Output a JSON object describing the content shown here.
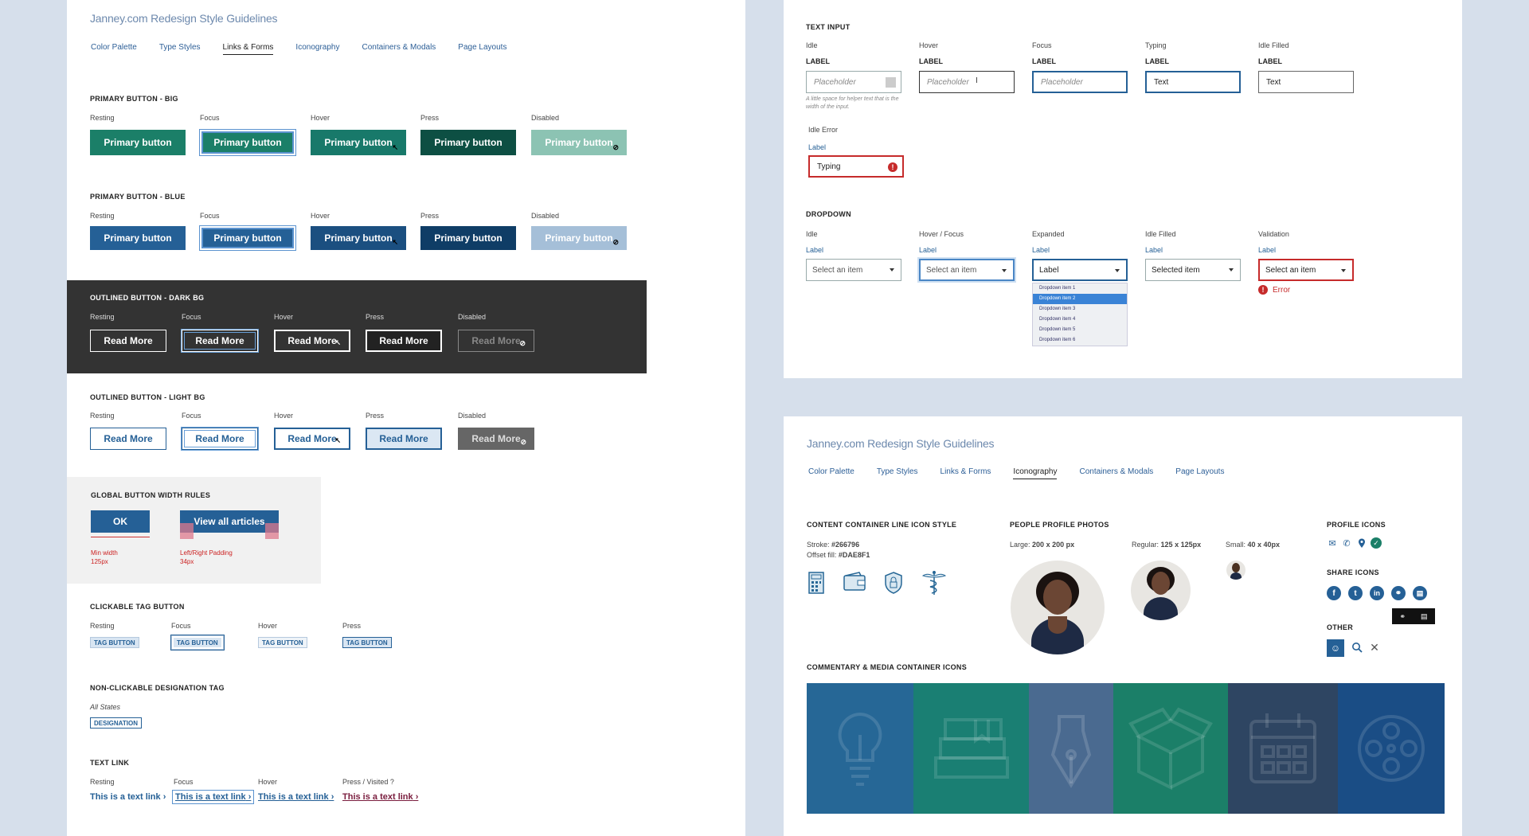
{
  "left": {
    "title": "Janney.com Redesign Style Guidelines",
    "nav": [
      "Color Palette",
      "Type Styles",
      "Links & Forms",
      "Iconography",
      "Containers & Modals",
      "Page Layouts"
    ],
    "pb_big": {
      "heading": "PRIMARY BUTTON - BIG",
      "states": [
        "Resting",
        "Focus",
        "Hover",
        "Press",
        "Disabled"
      ],
      "label": "Primary button"
    },
    "pb_blue": {
      "heading": "PRIMARY BUTTON - BLUE",
      "states": [
        "Resting",
        "Focus",
        "Hover",
        "Press",
        "Disabled"
      ],
      "label": "Primary button"
    },
    "ob_dark": {
      "heading": "OUTLINED BUTTON - DARK BG",
      "states": [
        "Resting",
        "Focus",
        "Hover",
        "Press",
        "Disabled"
      ],
      "label": "Read More"
    },
    "ob_light": {
      "heading": "OUTLINED BUTTON - LIGHT BG",
      "states": [
        "Resting",
        "Focus",
        "Hover",
        "Press",
        "Disabled"
      ],
      "label": "Read More"
    },
    "gbw": {
      "heading": "GLOBAL BUTTON WIDTH RULES",
      "ok": "OK",
      "view": "View all articles",
      "min_a": "Min width",
      "min_b": "125px",
      "pad_a": "Left/Right Padding",
      "pad_b": "34px"
    },
    "tag": {
      "heading": "CLICKABLE TAG BUTTON",
      "states": [
        "Resting",
        "Focus",
        "Hover",
        "Press"
      ],
      "label": "TAG BUTTON"
    },
    "des": {
      "heading": "NON-CLICKABLE DESIGNATION TAG",
      "state": "All States",
      "label": "DESIGNATION"
    },
    "link": {
      "heading": "TEXT LINK",
      "states": [
        "Resting",
        "Focus",
        "Hover",
        "Press / Visited ?"
      ],
      "label": "This is a text link"
    }
  },
  "topright": {
    "ti_heading": "TEXT INPUT",
    "ti_states": [
      "Idle",
      "Hover",
      "Focus",
      "Typing",
      "Idle Filled"
    ],
    "ti_label": "LABEL",
    "ti_values": [
      "Placeholder",
      "Placeholder",
      "Placeholder",
      "Text",
      "Text"
    ],
    "helper": "A little space for helper text that is the width of the input.",
    "err_state": "Idle Error",
    "err_label": "Label",
    "err_value": "Typing",
    "dd_heading": "DROPDOWN",
    "dd_states": [
      "Idle",
      "Hover / Focus",
      "Expanded",
      "Idle Filled",
      "Validation"
    ],
    "dd_label": "Label",
    "dd_values": [
      "Select an item",
      "Select an item",
      "Label",
      "Selected item",
      "Select an item"
    ],
    "dd_items": [
      "Dropdown item 1",
      "Dropdown item 2",
      "Dropdown item 3",
      "Dropdown item 4",
      "Dropdown item 5",
      "Dropdown item 6"
    ],
    "dd_error": "Error"
  },
  "bottomright": {
    "title": "Janney.com Redesign Style Guidelines",
    "nav": [
      "Color Palette",
      "Type Styles",
      "Links & Forms",
      "Iconography",
      "Containers & Modals",
      "Page Layouts"
    ],
    "c1_heading": "CONTENT CONTAINER LINE ICON STYLE",
    "stroke_label": "Stroke:",
    "stroke": "#266796",
    "offset_label": "Offset fill:",
    "offset": "#DAE8F1",
    "c2_heading": "PEOPLE PROFILE PHOTOS",
    "large": "Large:",
    "large_v": "200 x 200 px",
    "regular": "Regular:",
    "regular_v": "125 x 125px",
    "small": "Small:",
    "small_v": "40 x 40px",
    "c3_heading": "PROFILE ICONS",
    "share_heading": "SHARE ICONS",
    "other_heading": "OTHER",
    "cm_heading": "COMMENTARY & MEDIA CONTAINER ICONS",
    "tile_colors": [
      "#266796",
      "#1a7f73",
      "#4a6a90",
      "#1b7f68",
      "#2e4562",
      "#1a4d85"
    ]
  }
}
